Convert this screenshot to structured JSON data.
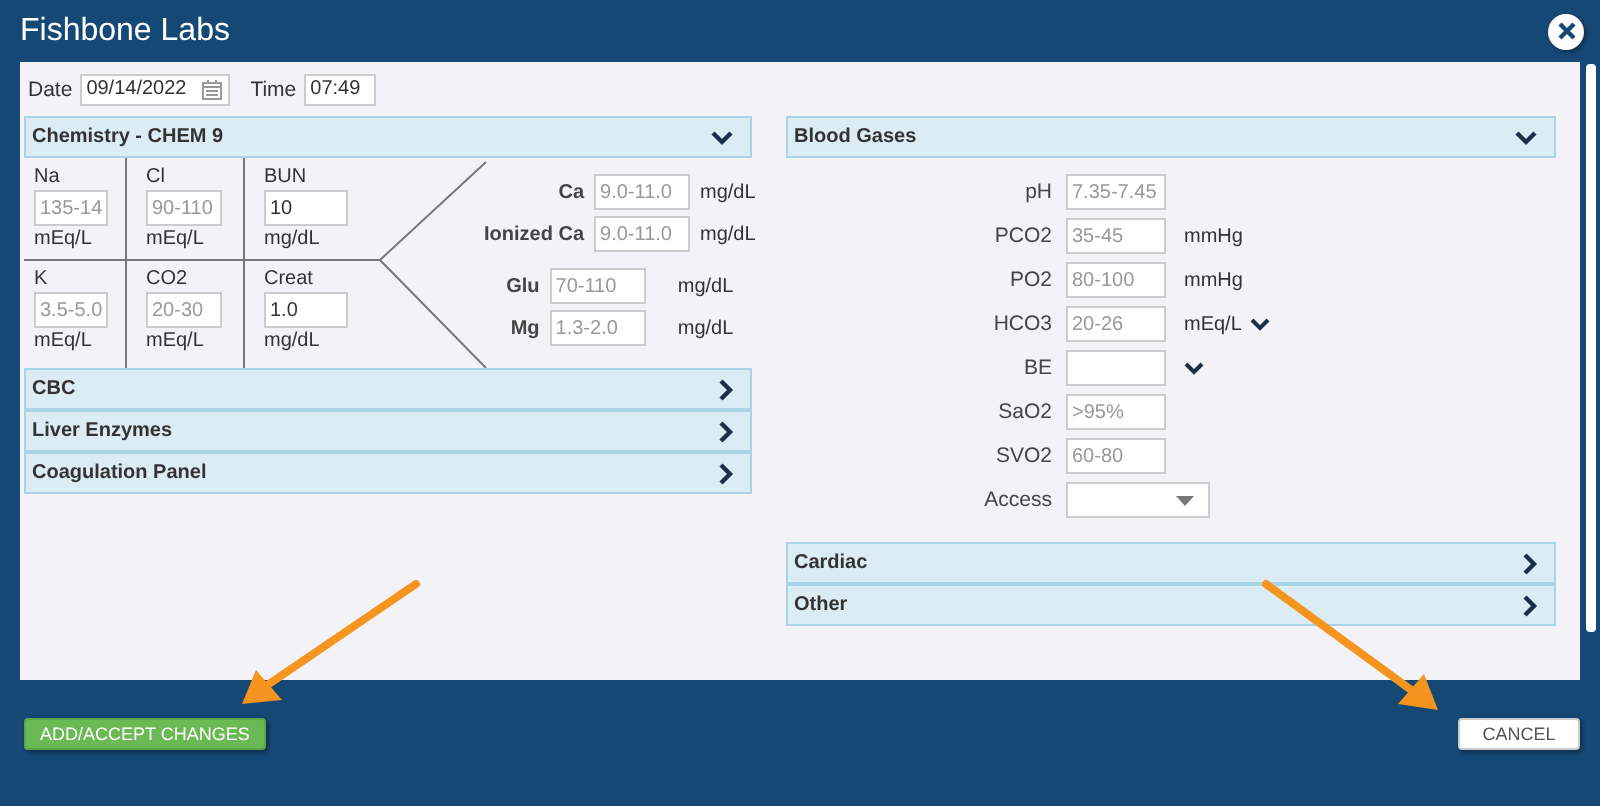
{
  "window": {
    "title": "Fishbone Labs"
  },
  "date": {
    "label": "Date",
    "value": "09/14/2022"
  },
  "time": {
    "label": "Time",
    "value": "07:49"
  },
  "chemistry": {
    "title": "Chemistry - CHEM 9",
    "expanded": true,
    "cells": [
      {
        "label": "Na",
        "placeholder": "135-14",
        "unit": "mEq/L"
      },
      {
        "label": "Cl",
        "placeholder": "90-110",
        "unit": "mEq/L"
      },
      {
        "label": "BUN",
        "value": "10",
        "unit": "mg/dL"
      },
      {
        "label": "K",
        "placeholder": "3.5-5.0",
        "unit": "mEq/L"
      },
      {
        "label": "CO2",
        "placeholder": "20-30",
        "unit": "mEq/L"
      },
      {
        "label": "Creat",
        "value": "1.0",
        "unit": "mg/dL"
      }
    ],
    "side_groups": [
      [
        {
          "label": "Ca",
          "placeholder": "9.0-11.0",
          "unit": "mg/dL"
        },
        {
          "label": "Ionized Ca",
          "placeholder": "9.0-11.0",
          "unit": "mg/dL"
        }
      ],
      [
        {
          "label": "Glu",
          "placeholder": "70-110",
          "unit": "mg/dL"
        },
        {
          "label": "Mg",
          "placeholder": "1.3-2.0",
          "unit": "mg/dL"
        }
      ]
    ]
  },
  "left_sections": [
    {
      "title": "CBC",
      "expanded": false
    },
    {
      "title": "Liver Enzymes",
      "expanded": false
    },
    {
      "title": "Coagulation Panel",
      "expanded": false
    }
  ],
  "blood_gases": {
    "title": "Blood Gases",
    "expanded": true,
    "rows": [
      {
        "kind": "field",
        "label": "pH",
        "placeholder": "7.35-7.45"
      },
      {
        "kind": "field",
        "label": "PCO2",
        "placeholder": "35-45",
        "unit": "mmHg"
      },
      {
        "kind": "field",
        "label": "PO2",
        "placeholder": "80-100",
        "unit": "mmHg"
      },
      {
        "kind": "menu",
        "label": "HCO3",
        "placeholder": "20-26",
        "unit": "mEq/L"
      },
      {
        "kind": "menu",
        "label": "BE"
      },
      {
        "kind": "field",
        "label": "SaO2",
        "placeholder": ">95%"
      },
      {
        "kind": "field",
        "label": "SVO2",
        "placeholder": "60-80"
      },
      {
        "kind": "select",
        "label": "Access"
      }
    ]
  },
  "right_sections": [
    {
      "title": "Cardiac",
      "expanded": false
    },
    {
      "title": "Other",
      "expanded": false
    }
  ],
  "buttons": [
    {
      "label": "ADD/ACCEPT CHANGES",
      "kind": "primary"
    },
    {
      "label": "CANCEL",
      "kind": "secondary"
    }
  ]
}
